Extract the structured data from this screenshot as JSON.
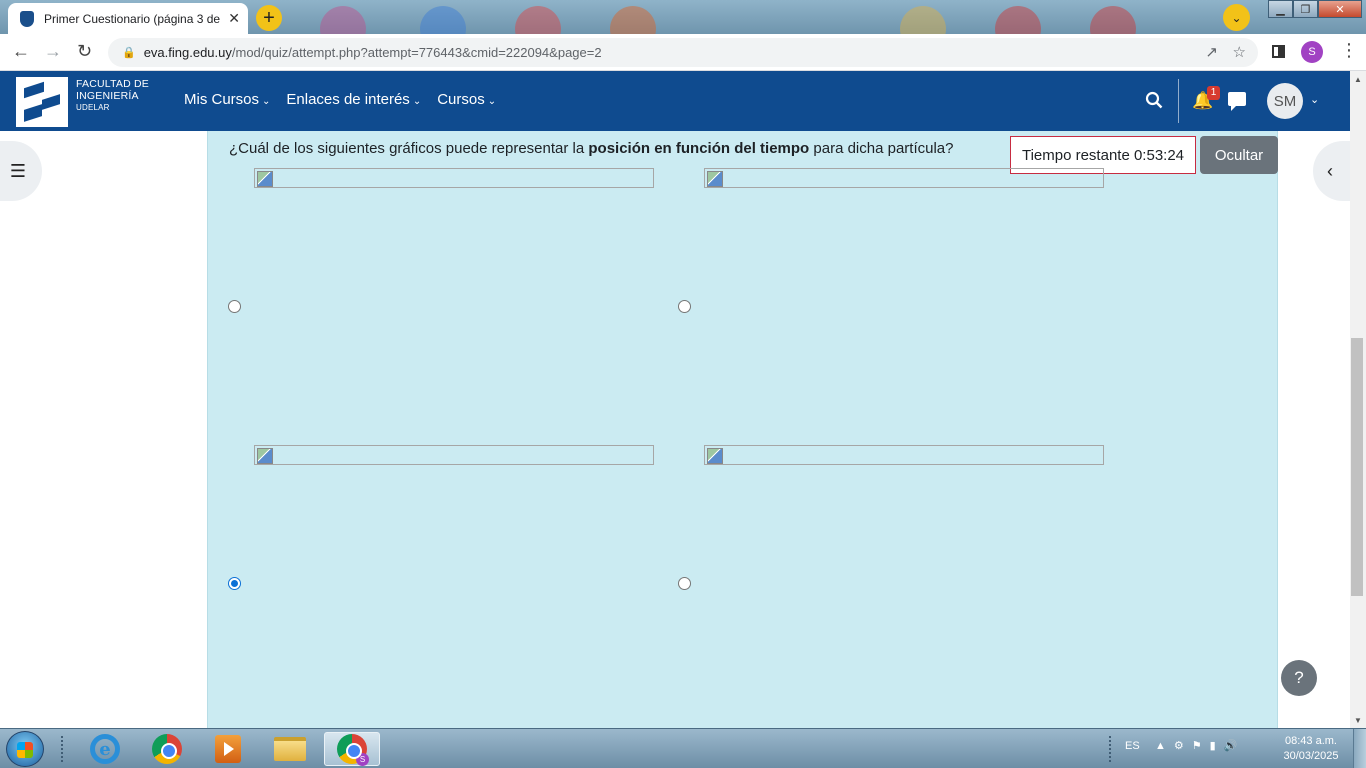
{
  "browser": {
    "tab_title": "Primer Cuestionario (página 3 de",
    "tab_close": "✕",
    "new_tab": "+",
    "tab_search": "⌄",
    "url_domain": "eva.fing.edu.uy",
    "url_path": "/mod/quiz/attempt.php?attempt=776443&cmid=222094&page=2",
    "profile_letter": "S",
    "window_controls": {
      "minimize": "▁",
      "maximize": "❐",
      "close": "✕"
    }
  },
  "site": {
    "logo_line1": "FACULTAD DE",
    "logo_line2": "INGENIERÍA",
    "logo_line3": "UDELAR",
    "menu": [
      {
        "label": "Mis Cursos"
      },
      {
        "label": "Enlaces de interés"
      },
      {
        "label": "Cursos"
      }
    ],
    "notification_count": "1",
    "avatar_initials": "SM"
  },
  "quiz": {
    "question_prefix": "¿Cuál de los siguientes gráficos puede representar la ",
    "question_bold": "posición en función del tiempo",
    "question_suffix": " para dicha partícula?",
    "timer_text": "Tiempo restante 0:53:24",
    "hide_button": "Ocultar",
    "options": [
      {
        "label": "option-1",
        "checked": false
      },
      {
        "label": "option-2",
        "checked": false
      },
      {
        "label": "option-3",
        "checked": true
      },
      {
        "label": "option-4",
        "checked": false
      }
    ],
    "help_label": "?"
  },
  "taskbar": {
    "language": "ES",
    "time": "08:43 a.m.",
    "date": "30/03/2025"
  },
  "colors": {
    "navbar": "#0f4b8f",
    "question_bg": "#cbebf2",
    "timer_border": "#c72c41",
    "radio_checked": "#0b70d6"
  }
}
